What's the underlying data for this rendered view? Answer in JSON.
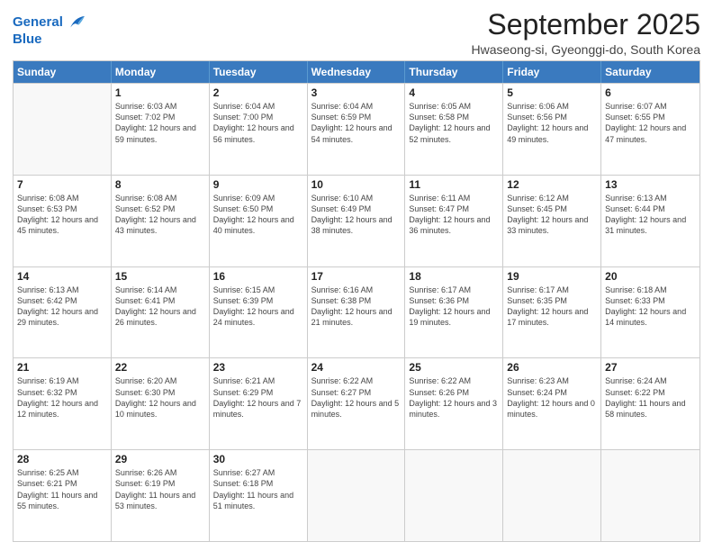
{
  "logo": {
    "line1": "General",
    "line2": "Blue"
  },
  "title": "September 2025",
  "location": "Hwaseong-si, Gyeonggi-do, South Korea",
  "header_days": [
    "Sunday",
    "Monday",
    "Tuesday",
    "Wednesday",
    "Thursday",
    "Friday",
    "Saturday"
  ],
  "weeks": [
    [
      {
        "day": "",
        "sunrise": "",
        "sunset": "",
        "daylight": ""
      },
      {
        "day": "1",
        "sunrise": "Sunrise: 6:03 AM",
        "sunset": "Sunset: 7:02 PM",
        "daylight": "Daylight: 12 hours and 59 minutes."
      },
      {
        "day": "2",
        "sunrise": "Sunrise: 6:04 AM",
        "sunset": "Sunset: 7:00 PM",
        "daylight": "Daylight: 12 hours and 56 minutes."
      },
      {
        "day": "3",
        "sunrise": "Sunrise: 6:04 AM",
        "sunset": "Sunset: 6:59 PM",
        "daylight": "Daylight: 12 hours and 54 minutes."
      },
      {
        "day": "4",
        "sunrise": "Sunrise: 6:05 AM",
        "sunset": "Sunset: 6:58 PM",
        "daylight": "Daylight: 12 hours and 52 minutes."
      },
      {
        "day": "5",
        "sunrise": "Sunrise: 6:06 AM",
        "sunset": "Sunset: 6:56 PM",
        "daylight": "Daylight: 12 hours and 49 minutes."
      },
      {
        "day": "6",
        "sunrise": "Sunrise: 6:07 AM",
        "sunset": "Sunset: 6:55 PM",
        "daylight": "Daylight: 12 hours and 47 minutes."
      }
    ],
    [
      {
        "day": "7",
        "sunrise": "Sunrise: 6:08 AM",
        "sunset": "Sunset: 6:53 PM",
        "daylight": "Daylight: 12 hours and 45 minutes."
      },
      {
        "day": "8",
        "sunrise": "Sunrise: 6:08 AM",
        "sunset": "Sunset: 6:52 PM",
        "daylight": "Daylight: 12 hours and 43 minutes."
      },
      {
        "day": "9",
        "sunrise": "Sunrise: 6:09 AM",
        "sunset": "Sunset: 6:50 PM",
        "daylight": "Daylight: 12 hours and 40 minutes."
      },
      {
        "day": "10",
        "sunrise": "Sunrise: 6:10 AM",
        "sunset": "Sunset: 6:49 PM",
        "daylight": "Daylight: 12 hours and 38 minutes."
      },
      {
        "day": "11",
        "sunrise": "Sunrise: 6:11 AM",
        "sunset": "Sunset: 6:47 PM",
        "daylight": "Daylight: 12 hours and 36 minutes."
      },
      {
        "day": "12",
        "sunrise": "Sunrise: 6:12 AM",
        "sunset": "Sunset: 6:45 PM",
        "daylight": "Daylight: 12 hours and 33 minutes."
      },
      {
        "day": "13",
        "sunrise": "Sunrise: 6:13 AM",
        "sunset": "Sunset: 6:44 PM",
        "daylight": "Daylight: 12 hours and 31 minutes."
      }
    ],
    [
      {
        "day": "14",
        "sunrise": "Sunrise: 6:13 AM",
        "sunset": "Sunset: 6:42 PM",
        "daylight": "Daylight: 12 hours and 29 minutes."
      },
      {
        "day": "15",
        "sunrise": "Sunrise: 6:14 AM",
        "sunset": "Sunset: 6:41 PM",
        "daylight": "Daylight: 12 hours and 26 minutes."
      },
      {
        "day": "16",
        "sunrise": "Sunrise: 6:15 AM",
        "sunset": "Sunset: 6:39 PM",
        "daylight": "Daylight: 12 hours and 24 minutes."
      },
      {
        "day": "17",
        "sunrise": "Sunrise: 6:16 AM",
        "sunset": "Sunset: 6:38 PM",
        "daylight": "Daylight: 12 hours and 21 minutes."
      },
      {
        "day": "18",
        "sunrise": "Sunrise: 6:17 AM",
        "sunset": "Sunset: 6:36 PM",
        "daylight": "Daylight: 12 hours and 19 minutes."
      },
      {
        "day": "19",
        "sunrise": "Sunrise: 6:17 AM",
        "sunset": "Sunset: 6:35 PM",
        "daylight": "Daylight: 12 hours and 17 minutes."
      },
      {
        "day": "20",
        "sunrise": "Sunrise: 6:18 AM",
        "sunset": "Sunset: 6:33 PM",
        "daylight": "Daylight: 12 hours and 14 minutes."
      }
    ],
    [
      {
        "day": "21",
        "sunrise": "Sunrise: 6:19 AM",
        "sunset": "Sunset: 6:32 PM",
        "daylight": "Daylight: 12 hours and 12 minutes."
      },
      {
        "day": "22",
        "sunrise": "Sunrise: 6:20 AM",
        "sunset": "Sunset: 6:30 PM",
        "daylight": "Daylight: 12 hours and 10 minutes."
      },
      {
        "day": "23",
        "sunrise": "Sunrise: 6:21 AM",
        "sunset": "Sunset: 6:29 PM",
        "daylight": "Daylight: 12 hours and 7 minutes."
      },
      {
        "day": "24",
        "sunrise": "Sunrise: 6:22 AM",
        "sunset": "Sunset: 6:27 PM",
        "daylight": "Daylight: 12 hours and 5 minutes."
      },
      {
        "day": "25",
        "sunrise": "Sunrise: 6:22 AM",
        "sunset": "Sunset: 6:26 PM",
        "daylight": "Daylight: 12 hours and 3 minutes."
      },
      {
        "day": "26",
        "sunrise": "Sunrise: 6:23 AM",
        "sunset": "Sunset: 6:24 PM",
        "daylight": "Daylight: 12 hours and 0 minutes."
      },
      {
        "day": "27",
        "sunrise": "Sunrise: 6:24 AM",
        "sunset": "Sunset: 6:22 PM",
        "daylight": "Daylight: 11 hours and 58 minutes."
      }
    ],
    [
      {
        "day": "28",
        "sunrise": "Sunrise: 6:25 AM",
        "sunset": "Sunset: 6:21 PM",
        "daylight": "Daylight: 11 hours and 55 minutes."
      },
      {
        "day": "29",
        "sunrise": "Sunrise: 6:26 AM",
        "sunset": "Sunset: 6:19 PM",
        "daylight": "Daylight: 11 hours and 53 minutes."
      },
      {
        "day": "30",
        "sunrise": "Sunrise: 6:27 AM",
        "sunset": "Sunset: 6:18 PM",
        "daylight": "Daylight: 11 hours and 51 minutes."
      },
      {
        "day": "",
        "sunrise": "",
        "sunset": "",
        "daylight": ""
      },
      {
        "day": "",
        "sunrise": "",
        "sunset": "",
        "daylight": ""
      },
      {
        "day": "",
        "sunrise": "",
        "sunset": "",
        "daylight": ""
      },
      {
        "day": "",
        "sunrise": "",
        "sunset": "",
        "daylight": ""
      }
    ]
  ]
}
